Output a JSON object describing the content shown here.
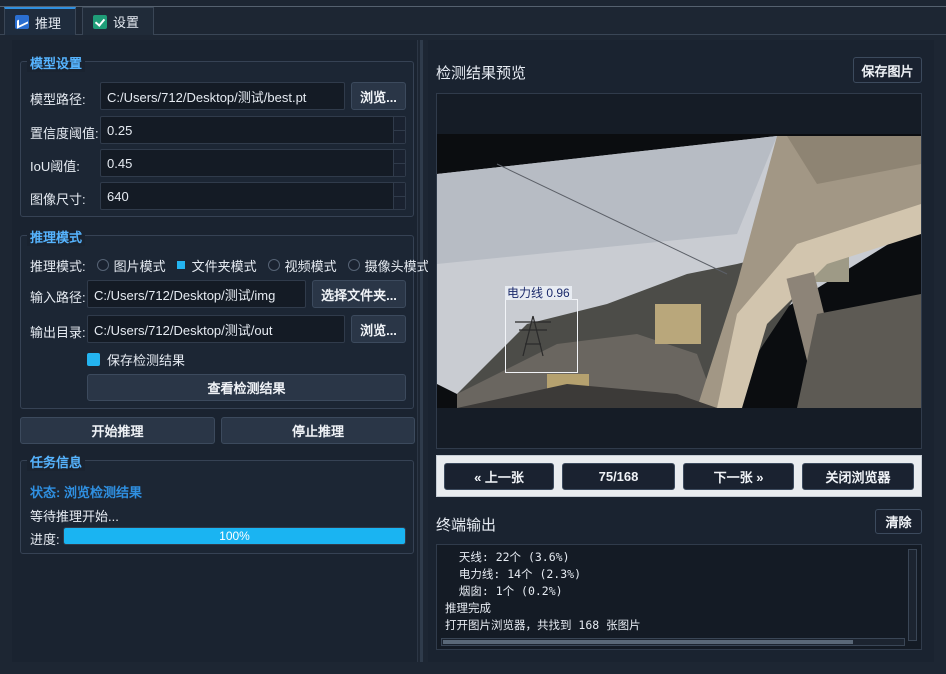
{
  "tabs": [
    {
      "label": "推理",
      "icon": "chart-icon",
      "active": true
    },
    {
      "label": "设置",
      "icon": "checkbox-icon",
      "active": false
    }
  ],
  "model_settings": {
    "title": "模型设置",
    "model_path_label": "模型路径:",
    "model_path_value": "C:/Users/712/Desktop/测试/best.pt",
    "browse_label": "浏览...",
    "conf_label": "置信度阈值:",
    "conf_value": "0.25",
    "iou_label": "IoU阈值:",
    "iou_value": "0.45",
    "imgsz_label": "图像尺寸:",
    "imgsz_value": "640"
  },
  "infer_mode": {
    "title": "推理模式",
    "mode_label": "推理模式:",
    "modes": [
      {
        "label": "图片模式",
        "checked": false
      },
      {
        "label": "文件夹模式",
        "checked": true
      },
      {
        "label": "视频模式",
        "checked": false
      },
      {
        "label": "摄像头模式",
        "checked": false
      }
    ],
    "input_label": "输入路径:",
    "input_value": "C:/Users/712/Desktop/测试/img",
    "select_folder_label": "选择文件夹...",
    "output_label": "输出目录:",
    "output_value": "C:/Users/712/Desktop/测试/out",
    "output_browse_label": "浏览...",
    "save_results_label": "保存检测结果",
    "save_results_checked": true,
    "view_results_label": "查看检测结果"
  },
  "actions": {
    "start_label": "开始推理",
    "stop_label": "停止推理"
  },
  "task_info": {
    "title": "任务信息",
    "status": "状态: 浏览检测结果",
    "message": "等待推理开始...",
    "progress_label": "进度:",
    "progress_value": 100,
    "progress_text": "100%"
  },
  "preview": {
    "title": "检测结果预览",
    "save_image_label": "保存图片",
    "detection_label": "电力线 0.96",
    "prev_label": "« 上一张",
    "counter": "75/168",
    "next_label": "下一张 »",
    "close_label": "关闭浏览器"
  },
  "terminal": {
    "title": "终端输出",
    "clear_label": "清除",
    "lines": [
      "  天线: 22个 (3.6%)",
      "  电力线: 14个 (2.3%)",
      "  烟囱: 1个 (0.2%)",
      "推理完成",
      "打开图片浏览器，共找到 168 张图片"
    ]
  },
  "colors": {
    "accent": "#56b4ff",
    "progress": "#1ab4f2",
    "background": "#1d2633"
  }
}
